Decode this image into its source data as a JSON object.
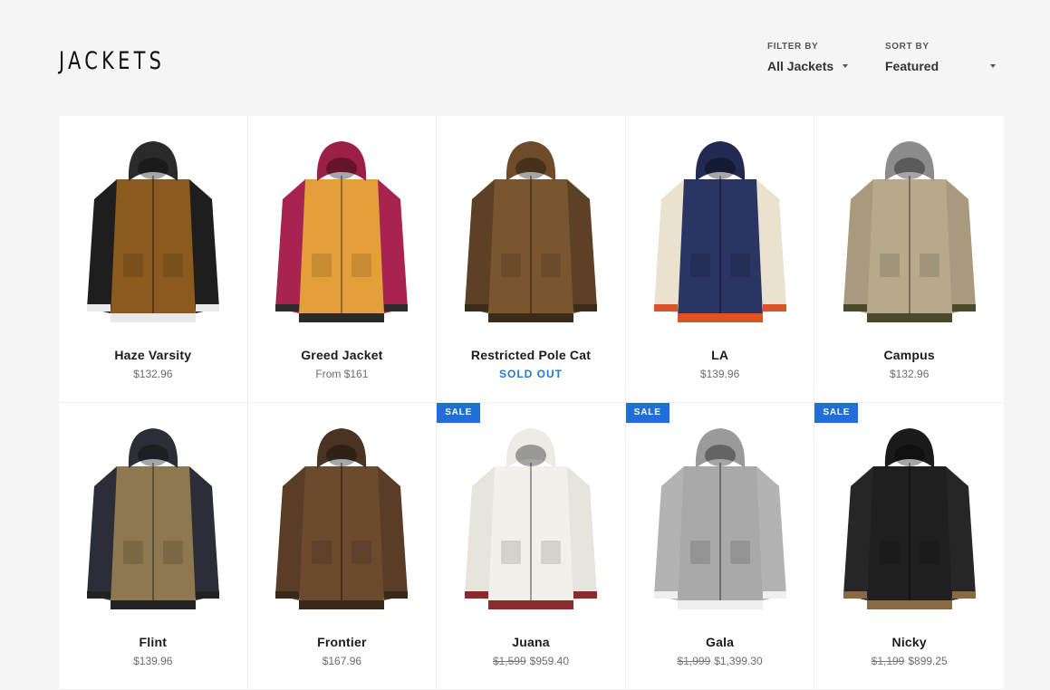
{
  "page": {
    "title": "JACKETS"
  },
  "filter": {
    "label": "FILTER BY",
    "value": "All Jackets"
  },
  "sort": {
    "label": "SORT BY",
    "value": "Featured"
  },
  "products": [
    {
      "name": "Haze Varsity",
      "price": "$132.96",
      "icon": "jacket-varsity-brown-icon",
      "colors": {
        "body": "#8a5a1e",
        "sleeve": "#1e1e1e",
        "hood": "#2a2a2a",
        "trim": "#e8e8e8"
      }
    },
    {
      "name": "Greed Jacket",
      "price": "From $161",
      "icon": "jacket-magenta-mustard-icon",
      "colors": {
        "body": "#e3a03a",
        "sleeve": "#a8234f",
        "hood": "#9c1f48",
        "trim": "#2a2a2a"
      }
    },
    {
      "name": "Restricted Pole Cat",
      "price": "SOLD OUT",
      "icon": "jacket-camo-icon",
      "colors": {
        "body": "#7a5630",
        "sleeve": "#5d4126",
        "hood": "#6e4c2a",
        "trim": "#3b2b1a"
      }
    },
    {
      "name": "LA",
      "price": "$139.96",
      "icon": "jacket-navy-cream-icon",
      "colors": {
        "body": "#2b3563",
        "sleeve": "#e9e2cf",
        "hood": "#222a52",
        "trim": "#d9542b"
      }
    },
    {
      "name": "Campus",
      "price": "$132.96",
      "icon": "jacket-speckled-icon",
      "colors": {
        "body": "#b7a98a",
        "sleeve": "#a89a7c",
        "hood": "#8c8c8c",
        "trim": "#4a4a2a"
      }
    },
    {
      "name": "Flint",
      "price": "$139.96",
      "icon": "jacket-anorak-icon",
      "colors": {
        "body": "#8d7850",
        "sleeve": "#2b2e36",
        "hood": "#2b2e36",
        "trim": "#222"
      }
    },
    {
      "name": "Frontier",
      "price": "$167.96",
      "icon": "jacket-leopard-brown-icon",
      "colors": {
        "body": "#6b4a2e",
        "sleeve": "#5a3d27",
        "hood": "#4a3322",
        "trim": "#3a2818"
      }
    },
    {
      "name": "Juana",
      "sale": true,
      "badge": "SALE",
      "old_price": "$1,599",
      "price": "$959.40",
      "icon": "jacket-white-puffer-icon",
      "colors": {
        "body": "#f1f0ea",
        "sleeve": "#e6e4dc",
        "hood": "#ecebe5",
        "trim": "#8b2a2a"
      }
    },
    {
      "name": "Gala",
      "sale": true,
      "badge": "SALE",
      "old_price": "$1,999",
      "price": "$1,399.30",
      "icon": "jacket-grey-knit-icon",
      "colors": {
        "body": "#a9a9a9",
        "sleeve": "#b3b3b3",
        "hood": "#9a9a9a",
        "trim": "#efefef"
      }
    },
    {
      "name": "Nicky",
      "sale": true,
      "badge": "SALE",
      "old_price": "$1,199",
      "price": "$899.25",
      "icon": "jacket-black-puffer-icon",
      "colors": {
        "body": "#1f1f1f",
        "sleeve": "#262626",
        "hood": "#1a1a1a",
        "trim": "#8a6a40"
      }
    }
  ]
}
